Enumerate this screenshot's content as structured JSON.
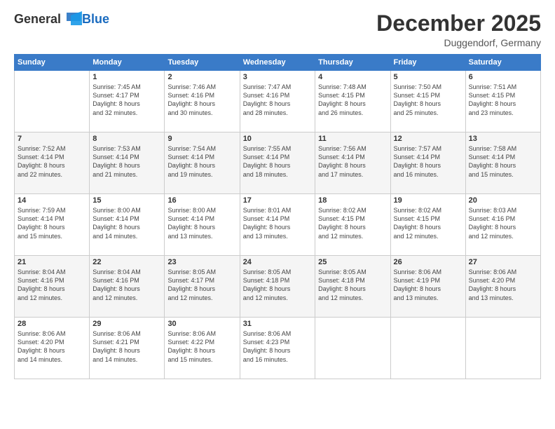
{
  "header": {
    "logo_general": "General",
    "logo_blue": "Blue",
    "month_title": "December 2025",
    "location": "Duggendorf, Germany"
  },
  "days_of_week": [
    "Sunday",
    "Monday",
    "Tuesday",
    "Wednesday",
    "Thursday",
    "Friday",
    "Saturday"
  ],
  "weeks": [
    [
      {
        "day": "",
        "info": ""
      },
      {
        "day": "1",
        "info": "Sunrise: 7:45 AM\nSunset: 4:17 PM\nDaylight: 8 hours\nand 32 minutes."
      },
      {
        "day": "2",
        "info": "Sunrise: 7:46 AM\nSunset: 4:16 PM\nDaylight: 8 hours\nand 30 minutes."
      },
      {
        "day": "3",
        "info": "Sunrise: 7:47 AM\nSunset: 4:16 PM\nDaylight: 8 hours\nand 28 minutes."
      },
      {
        "day": "4",
        "info": "Sunrise: 7:48 AM\nSunset: 4:15 PM\nDaylight: 8 hours\nand 26 minutes."
      },
      {
        "day": "5",
        "info": "Sunrise: 7:50 AM\nSunset: 4:15 PM\nDaylight: 8 hours\nand 25 minutes."
      },
      {
        "day": "6",
        "info": "Sunrise: 7:51 AM\nSunset: 4:15 PM\nDaylight: 8 hours\nand 23 minutes."
      }
    ],
    [
      {
        "day": "7",
        "info": "Sunrise: 7:52 AM\nSunset: 4:14 PM\nDaylight: 8 hours\nand 22 minutes."
      },
      {
        "day": "8",
        "info": "Sunrise: 7:53 AM\nSunset: 4:14 PM\nDaylight: 8 hours\nand 21 minutes."
      },
      {
        "day": "9",
        "info": "Sunrise: 7:54 AM\nSunset: 4:14 PM\nDaylight: 8 hours\nand 19 minutes."
      },
      {
        "day": "10",
        "info": "Sunrise: 7:55 AM\nSunset: 4:14 PM\nDaylight: 8 hours\nand 18 minutes."
      },
      {
        "day": "11",
        "info": "Sunrise: 7:56 AM\nSunset: 4:14 PM\nDaylight: 8 hours\nand 17 minutes."
      },
      {
        "day": "12",
        "info": "Sunrise: 7:57 AM\nSunset: 4:14 PM\nDaylight: 8 hours\nand 16 minutes."
      },
      {
        "day": "13",
        "info": "Sunrise: 7:58 AM\nSunset: 4:14 PM\nDaylight: 8 hours\nand 15 minutes."
      }
    ],
    [
      {
        "day": "14",
        "info": "Sunrise: 7:59 AM\nSunset: 4:14 PM\nDaylight: 8 hours\nand 15 minutes."
      },
      {
        "day": "15",
        "info": "Sunrise: 8:00 AM\nSunset: 4:14 PM\nDaylight: 8 hours\nand 14 minutes."
      },
      {
        "day": "16",
        "info": "Sunrise: 8:00 AM\nSunset: 4:14 PM\nDaylight: 8 hours\nand 13 minutes."
      },
      {
        "day": "17",
        "info": "Sunrise: 8:01 AM\nSunset: 4:14 PM\nDaylight: 8 hours\nand 13 minutes."
      },
      {
        "day": "18",
        "info": "Sunrise: 8:02 AM\nSunset: 4:15 PM\nDaylight: 8 hours\nand 12 minutes."
      },
      {
        "day": "19",
        "info": "Sunrise: 8:02 AM\nSunset: 4:15 PM\nDaylight: 8 hours\nand 12 minutes."
      },
      {
        "day": "20",
        "info": "Sunrise: 8:03 AM\nSunset: 4:16 PM\nDaylight: 8 hours\nand 12 minutes."
      }
    ],
    [
      {
        "day": "21",
        "info": "Sunrise: 8:04 AM\nSunset: 4:16 PM\nDaylight: 8 hours\nand 12 minutes."
      },
      {
        "day": "22",
        "info": "Sunrise: 8:04 AM\nSunset: 4:16 PM\nDaylight: 8 hours\nand 12 minutes."
      },
      {
        "day": "23",
        "info": "Sunrise: 8:05 AM\nSunset: 4:17 PM\nDaylight: 8 hours\nand 12 minutes."
      },
      {
        "day": "24",
        "info": "Sunrise: 8:05 AM\nSunset: 4:18 PM\nDaylight: 8 hours\nand 12 minutes."
      },
      {
        "day": "25",
        "info": "Sunrise: 8:05 AM\nSunset: 4:18 PM\nDaylight: 8 hours\nand 12 minutes."
      },
      {
        "day": "26",
        "info": "Sunrise: 8:06 AM\nSunset: 4:19 PM\nDaylight: 8 hours\nand 13 minutes."
      },
      {
        "day": "27",
        "info": "Sunrise: 8:06 AM\nSunset: 4:20 PM\nDaylight: 8 hours\nand 13 minutes."
      }
    ],
    [
      {
        "day": "28",
        "info": "Sunrise: 8:06 AM\nSunset: 4:20 PM\nDaylight: 8 hours\nand 14 minutes."
      },
      {
        "day": "29",
        "info": "Sunrise: 8:06 AM\nSunset: 4:21 PM\nDaylight: 8 hours\nand 14 minutes."
      },
      {
        "day": "30",
        "info": "Sunrise: 8:06 AM\nSunset: 4:22 PM\nDaylight: 8 hours\nand 15 minutes."
      },
      {
        "day": "31",
        "info": "Sunrise: 8:06 AM\nSunset: 4:23 PM\nDaylight: 8 hours\nand 16 minutes."
      },
      {
        "day": "",
        "info": ""
      },
      {
        "day": "",
        "info": ""
      },
      {
        "day": "",
        "info": ""
      }
    ]
  ]
}
